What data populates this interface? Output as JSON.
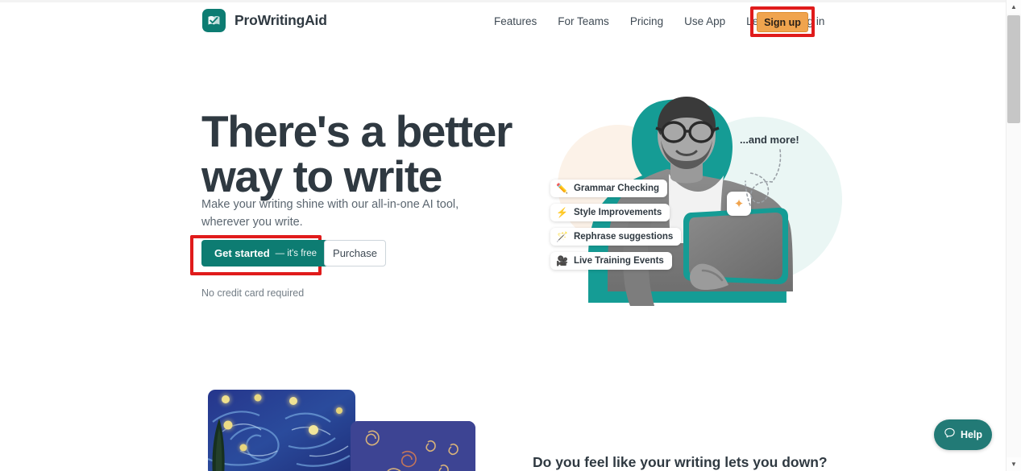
{
  "header": {
    "brand": {
      "name": "ProWritingAid",
      "logo_icon": "book-check-logo-icon",
      "logo_color": "#0d7c72"
    },
    "nav": [
      {
        "label": "Features",
        "name": "nav-features"
      },
      {
        "label": "For Teams",
        "name": "nav-for-teams"
      },
      {
        "label": "Pricing",
        "name": "nav-pricing"
      },
      {
        "label": "Use App",
        "name": "nav-use-app"
      },
      {
        "label": "Learn",
        "name": "nav-learn"
      },
      {
        "label": "Log in",
        "name": "nav-log-in"
      }
    ],
    "signup": {
      "label": "Sign up",
      "bg": "#f0a44e",
      "text_color": "#2b2118",
      "annotated": true
    }
  },
  "annotation": {
    "color": "#e01b1b",
    "targets": [
      "sign-up-button",
      "get-started-button"
    ]
  },
  "hero": {
    "title_line1": "There's a better",
    "title_line2": "way to write",
    "subtitle": "Make your writing shine with our all-in-one AI tool, wherever you write.",
    "cta_primary": {
      "label": "Get started",
      "suffix": "— it's free",
      "bg": "#0d7c72"
    },
    "cta_secondary": {
      "label": "Purchase"
    },
    "note": "No credit card required",
    "annotation_note": "...and more!",
    "sparkle_icon": "✦",
    "features": [
      {
        "icon": "✏️",
        "icon_name": "pencil-icon",
        "label": "Grammar Checking"
      },
      {
        "icon": "⚡",
        "icon_name": "lightning-icon",
        "label": "Style Improvements"
      },
      {
        "icon": "🪄",
        "icon_name": "magic-wand-icon",
        "label": "Rephrase suggestions"
      },
      {
        "icon": "🎥",
        "icon_name": "video-camera-icon",
        "label": "Live Training Events"
      }
    ]
  },
  "lower": {
    "heading": "Do you feel like your writing lets you down?"
  },
  "help_widget": {
    "label": "Help",
    "icon": "chat-bubble-icon",
    "bg": "#227a76"
  }
}
